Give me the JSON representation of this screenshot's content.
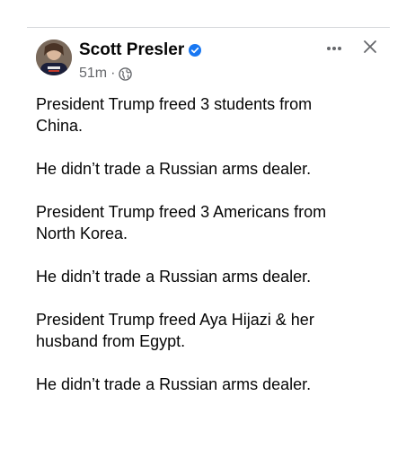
{
  "post": {
    "author": {
      "name": "Scott Presler",
      "verified": true
    },
    "meta": {
      "timestamp": "51m",
      "separator": "·",
      "audience_icon": "globe-icon"
    },
    "actions": {
      "more_icon": "more-horizontal-icon",
      "close_icon": "close-icon"
    },
    "paragraphs": [
      "President Trump freed 3 students from\nChina.",
      "He didn’t trade a Russian arms dealer.",
      "President Trump freed 3 Americans from\nNorth Korea.",
      "He didn’t trade a Russian arms dealer.",
      "President Trump freed Aya Hijazi & her\nhusband from Egypt.",
      "He didn’t trade a Russian arms dealer."
    ]
  },
  "colors": {
    "text": "#050505",
    "secondary_text": "#65676b",
    "verified_blue": "#1877f2",
    "divider": "#d5d7db"
  }
}
